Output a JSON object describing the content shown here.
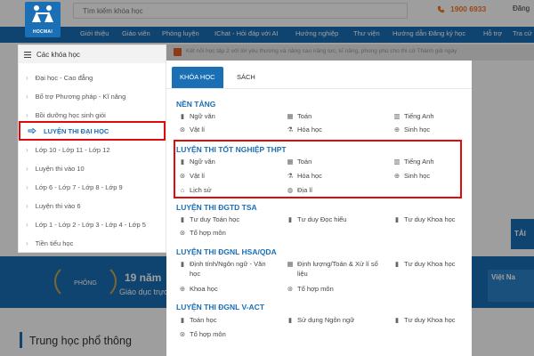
{
  "header": {
    "logo_text": "HOCMAI",
    "search_placeholder": "Tìm kiếm khóa học",
    "phone": "1900 6933",
    "login_label": "Đăng"
  },
  "nav": {
    "items": [
      "Giới thiệu",
      "Giáo viên",
      "Phòng luyện",
      "IChat - Hỏi đáp với AI",
      "Hướng nghiệp",
      "Thư viện",
      "Hướng dẫn Đăng ký học",
      "Hỗ trợ",
      "Tra cứ"
    ]
  },
  "sidebar": {
    "title": "Các khóa học",
    "items": [
      {
        "label": "Đại học - Cao đẳng"
      },
      {
        "label": "Bổ trợ Phương pháp - Kĩ năng"
      },
      {
        "label": "Bồi dưỡng học sinh giỏi"
      },
      {
        "label": "LUYỆN THI ĐẠI HỌC"
      },
      {
        "label": "Lớp 10 - Lớp 11 - Lớp 12"
      },
      {
        "label": "Luyện thi vào 10"
      },
      {
        "label": "Lớp 6 - Lớp 7 - Lớp 8 - Lớp 9"
      },
      {
        "label": "Luyện thi vào 6"
      },
      {
        "label": "Lớp 1 - Lớp 2 - Lớp 3 - Lớp 4 - Lớp 5"
      },
      {
        "label": "Tiền tiểu học"
      }
    ],
    "active_index": 3
  },
  "topic_bar": {
    "text": "Kết nối học tập 2 với lời yêu thương và nâng cao năng lực, kĩ năng, phong phú cho thi cử Thành giả ngày"
  },
  "dropdown": {
    "tabs": [
      "KHÓA HỌC",
      "SÁCH"
    ],
    "sections": [
      {
        "title": "NỀN TẢNG",
        "items": [
          "Ngữ văn",
          "Toán",
          "Tiếng Anh",
          "Vật lí",
          "Hóa học",
          "Sinh học"
        ]
      },
      {
        "title": "LUYỆN THI TỐT NGHIỆP THPT",
        "items": [
          "Ngữ văn",
          "Toán",
          "Tiếng Anh",
          "Vật lí",
          "Hóa học",
          "Sinh học",
          "Lịch sử",
          "Địa lí"
        ]
      },
      {
        "title": "LUYỆN THI ĐGTD TSA",
        "items": [
          "Tư duy Toán học",
          "Tư duy Đọc hiểu",
          "Tư duy Khoa học",
          "Tổ hợp môn"
        ]
      },
      {
        "title": "LUYỆN THI ĐGNL HSA/QDA",
        "items": [
          "Định tính/Ngôn ngữ - Văn học",
          "Định lượng/Toán & Xử lí số liệu",
          "Tư duy Khoa học",
          "Khoa học",
          "Tổ hợp môn",
          "Tổ hợp môn"
        ]
      },
      {
        "title": "LUYỆN THI ĐGNL V-ACT",
        "items": [
          "Toán học",
          "Sử dụng Ngôn ngữ",
          "Tư duy Khoa học",
          "Tổ hợp môn"
        ]
      }
    ]
  },
  "banner": {
    "text1": "19 năm",
    "text2": "Giáo dục trực",
    "right_text": "Việt Na",
    "tai_label": "TẢI",
    "laurel_text": "PHỎNG"
  },
  "section": {
    "title": "Trung học phổ thông"
  },
  "colors": {
    "brand": "#1b6fb5",
    "highlight": "#e10b0b",
    "accent": "#f47a20"
  }
}
